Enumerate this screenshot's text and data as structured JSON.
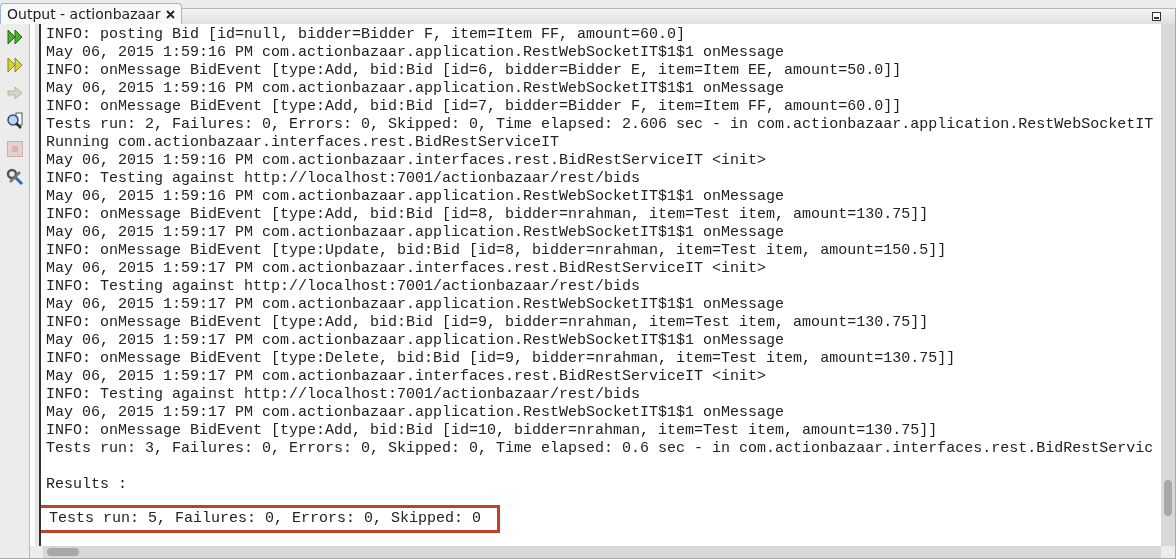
{
  "tab": {
    "title": "Output - actionbazaar",
    "selected": true
  },
  "toolbar": [
    {
      "kind": "rerun",
      "disabled": false
    },
    {
      "kind": "rerun-alt",
      "disabled": false
    },
    {
      "kind": "forward",
      "disabled": true
    },
    {
      "kind": "inspect",
      "disabled": false
    },
    {
      "kind": "stop",
      "disabled": true
    },
    {
      "kind": "settings",
      "disabled": false
    }
  ],
  "lines": [
    "INFO: posting Bid [id=null, bidder=Bidder F, item=Item FF, amount=60.0]",
    "May 06, 2015 1:59:16 PM com.actionbazaar.application.RestWebSocketIT$1$1 onMessage",
    "INFO: onMessage BidEvent [type:Add, bid:Bid [id=6, bidder=Bidder E, item=Item EE, amount=50.0]]",
    "May 06, 2015 1:59:16 PM com.actionbazaar.application.RestWebSocketIT$1$1 onMessage",
    "INFO: onMessage BidEvent [type:Add, bid:Bid [id=7, bidder=Bidder F, item=Item FF, amount=60.0]]",
    "Tests run: 2, Failures: 0, Errors: 0, Skipped: 0, Time elapsed: 2.606 sec - in com.actionbazaar.application.RestWebSocketIT",
    "Running com.actionbazaar.interfaces.rest.BidRestServiceIT",
    "May 06, 2015 1:59:16 PM com.actionbazaar.interfaces.rest.BidRestServiceIT <init>",
    "INFO: Testing against http://localhost:7001/actionbazaar/rest/bids",
    "May 06, 2015 1:59:16 PM com.actionbazaar.application.RestWebSocketIT$1$1 onMessage",
    "INFO: onMessage BidEvent [type:Add, bid:Bid [id=8, bidder=nrahman, item=Test item, amount=130.75]]",
    "May 06, 2015 1:59:17 PM com.actionbazaar.application.RestWebSocketIT$1$1 onMessage",
    "INFO: onMessage BidEvent [type:Update, bid:Bid [id=8, bidder=nrahman, item=Test item, amount=150.5]]",
    "May 06, 2015 1:59:17 PM com.actionbazaar.interfaces.rest.BidRestServiceIT <init>",
    "INFO: Testing against http://localhost:7001/actionbazaar/rest/bids",
    "May 06, 2015 1:59:17 PM com.actionbazaar.application.RestWebSocketIT$1$1 onMessage",
    "INFO: onMessage BidEvent [type:Add, bid:Bid [id=9, bidder=nrahman, item=Test item, amount=130.75]]",
    "May 06, 2015 1:59:17 PM com.actionbazaar.application.RestWebSocketIT$1$1 onMessage",
    "INFO: onMessage BidEvent [type:Delete, bid:Bid [id=9, bidder=nrahman, item=Test item, amount=130.75]]",
    "May 06, 2015 1:59:17 PM com.actionbazaar.interfaces.rest.BidRestServiceIT <init>",
    "INFO: Testing against http://localhost:7001/actionbazaar/rest/bids",
    "May 06, 2015 1:59:17 PM com.actionbazaar.application.RestWebSocketIT$1$1 onMessage",
    "INFO: onMessage BidEvent [type:Add, bid:Bid [id=10, bidder=nrahman, item=Test item, amount=130.75]]",
    "Tests run: 3, Failures: 0, Errors: 0, Skipped: 0, Time elapsed: 0.6 sec - in com.actionbazaar.interfaces.rest.BidRestServic"
  ],
  "summary": {
    "heading": "Results :",
    "result": "Tests run: 5, Failures: 0, Errors: 0, Skipped: 0",
    "highlighted": true
  }
}
